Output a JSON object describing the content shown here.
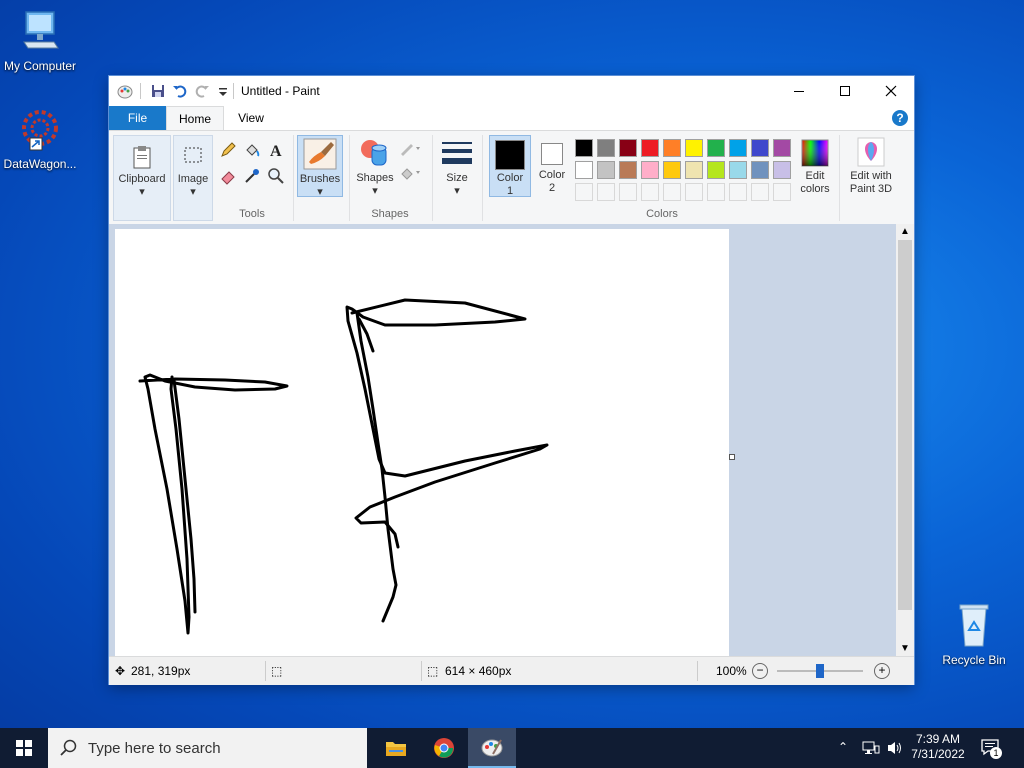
{
  "desktop": {
    "icons": [
      {
        "label": "My Computer"
      },
      {
        "label": "DataWagon..."
      },
      {
        "label": "Recycle Bin"
      }
    ]
  },
  "window": {
    "title": "Untitled - Paint",
    "tabs": {
      "file": "File",
      "home": "Home",
      "view": "View"
    },
    "ribbon": {
      "clipboard": "Clipboard",
      "image": "Image",
      "tools": "Tools",
      "brushes": "Brushes",
      "shapes": "Shapes",
      "shapes_group": "Shapes",
      "size": "Size",
      "color1_a": "Color",
      "color1_b": "1",
      "color2_a": "Color",
      "color2_b": "2",
      "edit_colors_a": "Edit",
      "edit_colors_b": "colors",
      "colors_group": "Colors",
      "paint3d_a": "Edit with",
      "paint3d_b": "Paint 3D"
    },
    "colors": {
      "row1": [
        "#000000",
        "#7f7f7f",
        "#880015",
        "#ed1c24",
        "#ff7f27",
        "#fff200",
        "#22b14c",
        "#00a2e8",
        "#3f48cc",
        "#a349a4"
      ],
      "row2": [
        "#ffffff",
        "#c3c3c3",
        "#b97a57",
        "#ffaec9",
        "#ffc90e",
        "#efe4b0",
        "#b5e61d",
        "#99d9ea",
        "#7092be",
        "#c8bfe7"
      ],
      "color1": "#000000",
      "color2": "#ffffff"
    },
    "status": {
      "cursor_pos": "281, 319px",
      "image_size": "614 × 460px",
      "zoom": "100%"
    }
  },
  "taskbar": {
    "search_placeholder": "Type here to search",
    "time": "7:39 AM",
    "date": "7/31/2022",
    "notification_count": "1"
  }
}
